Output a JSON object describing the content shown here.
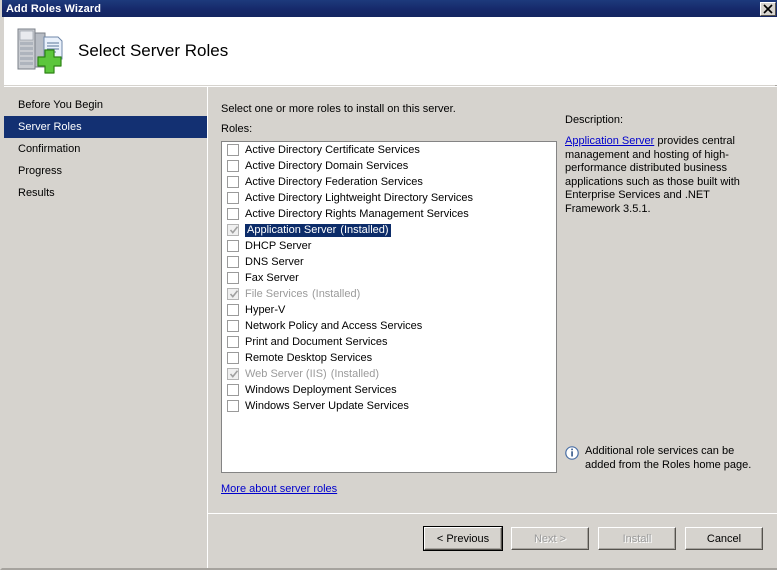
{
  "window": {
    "title": "Add Roles Wizard",
    "close_label": "x",
    "close_icon": "close-icon"
  },
  "header": {
    "title": "Select Server Roles",
    "icon": "server-add-icon"
  },
  "sidebar": {
    "items": [
      {
        "label": "Before You Begin",
        "selected": false
      },
      {
        "label": "Server Roles",
        "selected": true
      },
      {
        "label": "Confirmation",
        "selected": false
      },
      {
        "label": "Progress",
        "selected": false
      },
      {
        "label": "Results",
        "selected": false
      }
    ]
  },
  "main": {
    "instruction": "Select one or more roles to install on this server.",
    "roles_label": "Roles:",
    "more_link": "More about server roles",
    "roles": [
      {
        "label": "Active Directory Certificate Services",
        "suffix": "",
        "checked": false,
        "disabled": false,
        "selected": false
      },
      {
        "label": "Active Directory Domain Services",
        "suffix": "",
        "checked": false,
        "disabled": false,
        "selected": false
      },
      {
        "label": "Active Directory Federation Services",
        "suffix": "",
        "checked": false,
        "disabled": false,
        "selected": false
      },
      {
        "label": "Active Directory Lightweight Directory Services",
        "suffix": "",
        "checked": false,
        "disabled": false,
        "selected": false
      },
      {
        "label": "Active Directory Rights Management Services",
        "suffix": "",
        "checked": false,
        "disabled": false,
        "selected": false
      },
      {
        "label": "Application Server",
        "suffix": "(Installed)",
        "checked": true,
        "disabled": true,
        "selected": true
      },
      {
        "label": "DHCP Server",
        "suffix": "",
        "checked": false,
        "disabled": false,
        "selected": false
      },
      {
        "label": "DNS Server",
        "suffix": "",
        "checked": false,
        "disabled": false,
        "selected": false
      },
      {
        "label": "Fax Server",
        "suffix": "",
        "checked": false,
        "disabled": false,
        "selected": false
      },
      {
        "label": "File Services",
        "suffix": "(Installed)",
        "checked": true,
        "disabled": true,
        "selected": false
      },
      {
        "label": "Hyper-V",
        "suffix": "",
        "checked": false,
        "disabled": false,
        "selected": false
      },
      {
        "label": "Network Policy and Access Services",
        "suffix": "",
        "checked": false,
        "disabled": false,
        "selected": false
      },
      {
        "label": "Print and Document Services",
        "suffix": "",
        "checked": false,
        "disabled": false,
        "selected": false
      },
      {
        "label": "Remote Desktop Services",
        "suffix": "",
        "checked": false,
        "disabled": false,
        "selected": false
      },
      {
        "label": "Web Server (IIS)",
        "suffix": "(Installed)",
        "checked": true,
        "disabled": true,
        "selected": false
      },
      {
        "label": "Windows Deployment Services",
        "suffix": "",
        "checked": false,
        "disabled": false,
        "selected": false
      },
      {
        "label": "Windows Server Update Services",
        "suffix": "",
        "checked": false,
        "disabled": false,
        "selected": false
      }
    ]
  },
  "description": {
    "heading": "Description:",
    "link_text": "Application Server",
    "body_text": " provides central management and hosting of high-performance distributed business applications such as those built with Enterprise Services and .NET Framework 3.5.1.",
    "note": "Additional role services can be added from the Roles home page.",
    "note_icon": "info-icon"
  },
  "footer": {
    "buttons": [
      {
        "label": "< Previous",
        "disabled": false,
        "default": true
      },
      {
        "label": "Next >",
        "disabled": true,
        "default": false
      },
      {
        "label": "Install",
        "disabled": true,
        "default": false
      },
      {
        "label": "Cancel",
        "disabled": false,
        "default": false
      }
    ]
  },
  "colors": {
    "titlebar": "#16296a",
    "selection": "#133072",
    "face": "#d6d3ce",
    "link": "#0000cc",
    "disabled_text": "#9b9b9b"
  }
}
